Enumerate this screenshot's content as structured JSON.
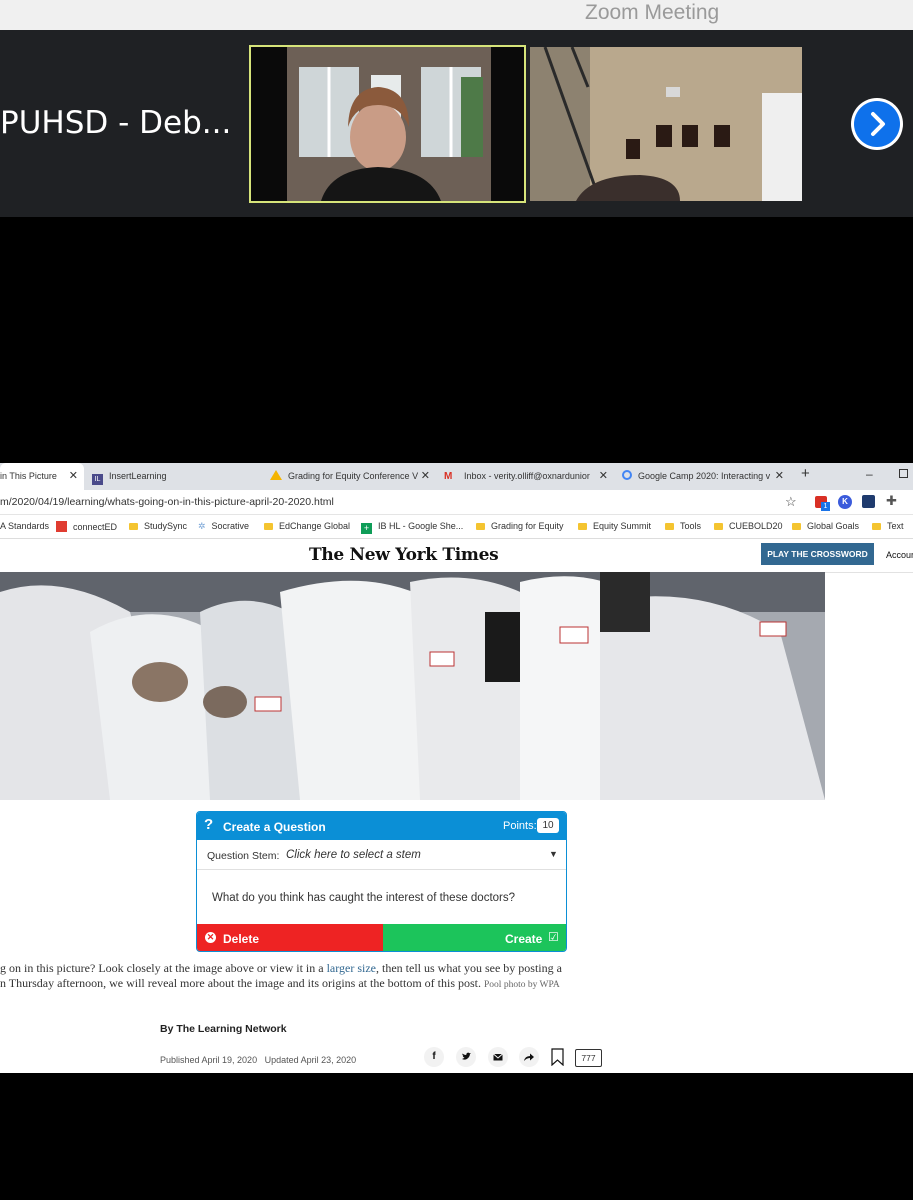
{
  "zoom": {
    "window_title": "Zoom Meeting",
    "participant_name": "PUHSD - Deb..."
  },
  "browser": {
    "tabs": [
      {
        "label": "in This Picture"
      },
      {
        "label": "InsertLearning"
      },
      {
        "label": "Grading for Equity Conference V"
      },
      {
        "label": "Inbox - verity.olliff@oxnardunior"
      },
      {
        "label": "Google Camp 2020: Interacting v"
      }
    ],
    "new_tab_label": "+",
    "url": "m/2020/04/19/learning/whats-going-on-in-this-picture-april-20-2020.html",
    "bookmarks": [
      "A Standards",
      "connectED",
      "StudySync",
      "Socrative",
      "EdChange Global",
      "IB HL - Google She...",
      "Grading for Equity",
      "Equity Summit",
      "Tools",
      "CUEBOLD20",
      "Global Goals",
      "Text"
    ],
    "extension_badge": "1",
    "extension_letter": "K"
  },
  "nyt": {
    "logo": "The New York Times",
    "crossword_button": "PLAY THE CROSSWORD",
    "account_label": "Accour"
  },
  "question_card": {
    "title": "Create a Question",
    "points_label": "Points:",
    "points_value": "10",
    "stem_label": "Question Stem:",
    "stem_placeholder": "Click here to select a stem",
    "question_text": "What do you think has caught the interest of these doctors?",
    "delete_label": "Delete",
    "create_label": "Create"
  },
  "article": {
    "caption_line1_a": "g on in this picture? Look closely at the image above or view it in a ",
    "caption_link": "larger size",
    "caption_line1_b": ", then tell us what you see by posting a",
    "caption_line2": "n Thursday afternoon, we will reveal more about the image and its origins at the bottom of this post.",
    "photo_credit": "Pool photo by WPA",
    "byline": "By The Learning Network",
    "published": "Published April 19, 2020",
    "updated": "Updated April 23, 2020",
    "comment_count": "777"
  }
}
